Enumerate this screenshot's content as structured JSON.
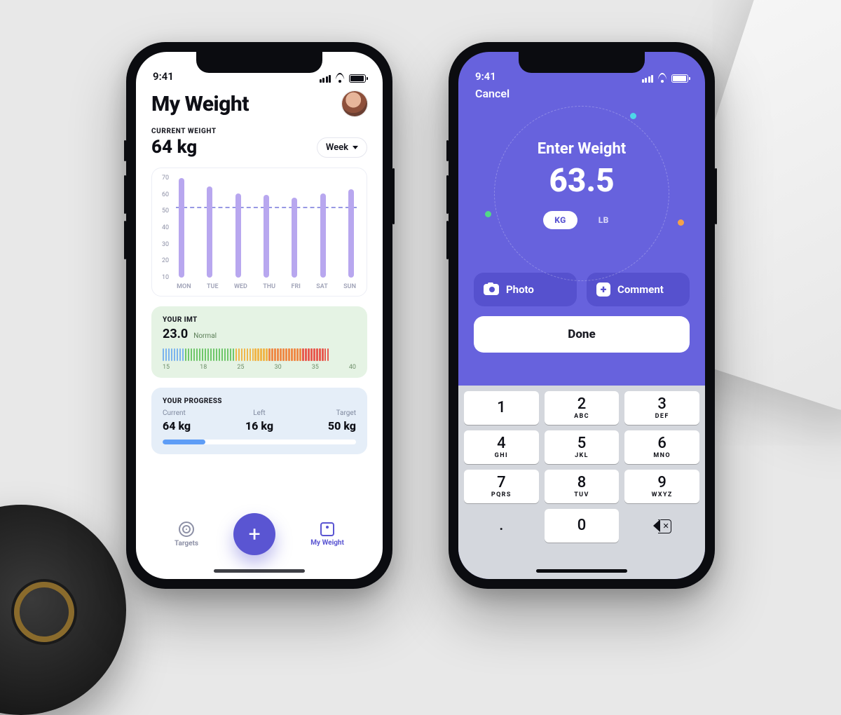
{
  "status": {
    "time": "9:41"
  },
  "screen_a": {
    "title": "My Weight",
    "current_weight_label": "CURRENT WEIGHT",
    "current_weight_value": "64 kg",
    "range_selector": "Week",
    "imt": {
      "label": "YOUR IMT",
      "value": "23.0",
      "status": "Normal",
      "scale": [
        "15",
        "18",
        "25",
        "30",
        "35",
        "40"
      ]
    },
    "progress": {
      "label": "YOUR PROGRESS",
      "current_label": "Current",
      "current_value": "64 kg",
      "left_label": "Left",
      "left_value": "16 kg",
      "target_label": "Target",
      "target_value": "50 kg",
      "percent": 22
    },
    "tabs": {
      "targets": "Targets",
      "my_weight": "My Weight"
    }
  },
  "screen_b": {
    "cancel": "Cancel",
    "title": "Enter Weight",
    "value": "63.5",
    "units": {
      "kg": "KG",
      "lb": "LB",
      "active": "kg"
    },
    "actions": {
      "photo": "Photo",
      "comment": "Comment"
    },
    "done": "Done",
    "keypad": {
      "keys": [
        {
          "digit": "1",
          "sub": ""
        },
        {
          "digit": "2",
          "sub": "ABC"
        },
        {
          "digit": "3",
          "sub": "DEF"
        },
        {
          "digit": "4",
          "sub": "GHI"
        },
        {
          "digit": "5",
          "sub": "JKL"
        },
        {
          "digit": "6",
          "sub": "MNO"
        },
        {
          "digit": "7",
          "sub": "PQRS"
        },
        {
          "digit": "8",
          "sub": "TUV"
        },
        {
          "digit": "9",
          "sub": "WXYZ"
        },
        {
          "digit": "0",
          "sub": ""
        }
      ],
      "dot": "."
    }
  },
  "chart_data": {
    "type": "bar",
    "title": "",
    "xlabel": "",
    "ylabel": "",
    "ylim": [
      0,
      70
    ],
    "yticks": [
      70,
      60,
      50,
      40,
      30,
      20,
      10
    ],
    "target_line": 50,
    "categories": [
      "MON",
      "TUE",
      "WED",
      "THU",
      "FRI",
      "SAT",
      "SUN"
    ],
    "values": [
      70,
      64,
      59,
      58,
      56,
      59,
      62
    ]
  }
}
